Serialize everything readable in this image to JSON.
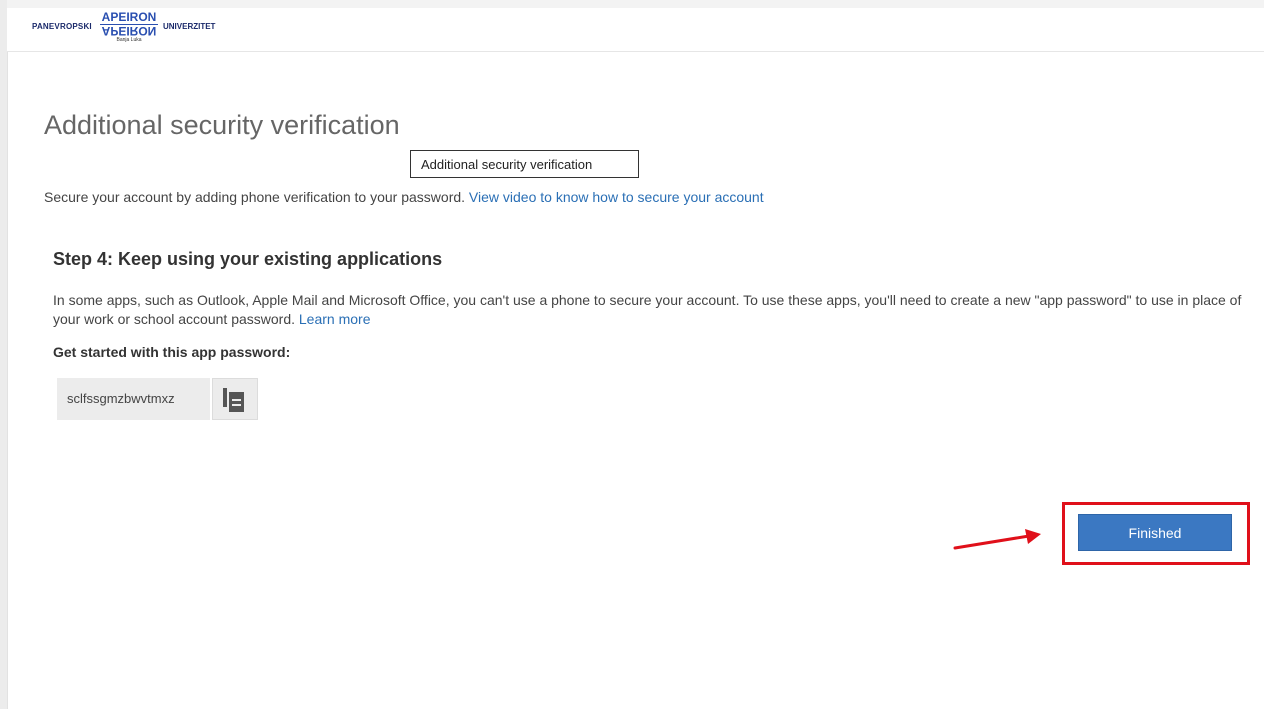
{
  "logo": {
    "left_word": "PANEVROPSKI",
    "center_word": "APEIRON",
    "center_word_mirrored": "APEIRON",
    "city": "Banja Luka",
    "right_word": "UNIVERZITET"
  },
  "page": {
    "title": "Additional security verification",
    "tooltip": "Additional security verification",
    "intro_text": "Secure your account by adding phone verification to your password.",
    "intro_link": "View video to know how to secure your account"
  },
  "step": {
    "heading": "Step 4: Keep using your existing applications",
    "description": "In some apps, such as Outlook, Apple Mail and Microsoft Office, you can't use a phone to secure your account. To use these apps, you'll need to create a new \"app password\" to use in place of your work or school account password.",
    "learn_more": "Learn more",
    "get_started_label": "Get started with this app password:",
    "app_password": "sclfssgmzbwvtmxz"
  },
  "icons": {
    "copy": "copy-icon",
    "annotation_arrow": "red-arrow-icon"
  },
  "actions": {
    "finished_label": "Finished"
  },
  "colors": {
    "accent": "#3b78c2",
    "link": "#2a6fb5",
    "highlight": "#e0101a"
  }
}
